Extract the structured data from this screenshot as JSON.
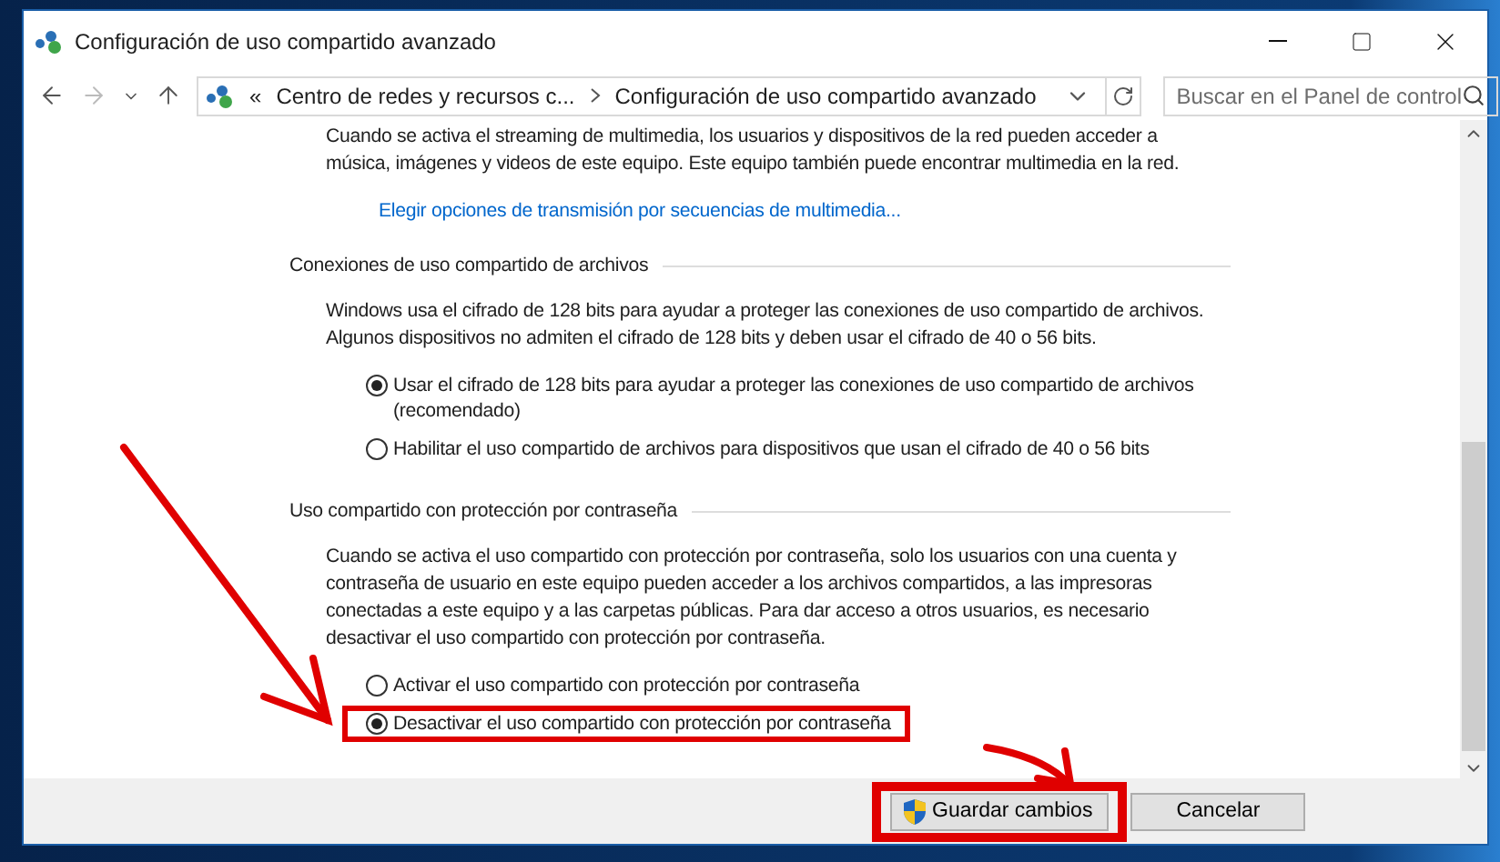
{
  "window": {
    "title": "Configuración de uso compartido avanzado"
  },
  "address_bar": {
    "overflow": "«",
    "crumbs": [
      {
        "label": "Centro de redes y recursos c..."
      },
      {
        "label": "Configuración de uso compartido avanzado"
      }
    ]
  },
  "search": {
    "placeholder": "Buscar en el Panel de control"
  },
  "intro": {
    "paragraph": "Cuando se activa el streaming de multimedia, los usuarios y dispositivos de la red pueden acceder a música, imágenes y videos de este equipo. Este equipo también puede encontrar multimedia en la red.",
    "link": "Elegir opciones de transmisión por secuencias de multimedia..."
  },
  "sections": [
    {
      "heading": "Conexiones de uso compartido de archivos",
      "paragraph": "Windows usa el cifrado de 128 bits para ayudar a proteger las conexiones de uso compartido de archivos. Algunos dispositivos no admiten el cifrado de 128 bits y deben usar el cifrado de 40 o 56 bits.",
      "options": [
        {
          "label": "Usar el cifrado de 128 bits para ayudar a proteger las conexiones de uso compartido de archivos (recomendado)",
          "selected": true,
          "highlighted": false
        },
        {
          "label": "Habilitar el uso compartido de archivos para dispositivos que usan el cifrado de 40 o 56 bits",
          "selected": false,
          "highlighted": false
        }
      ]
    },
    {
      "heading": "Uso compartido con protección por contraseña",
      "paragraph": "Cuando se activa el uso compartido con protección por contraseña, solo los usuarios con una cuenta y contraseña de usuario en este equipo pueden acceder a los archivos compartidos, a las impresoras conectadas a este equipo y a las carpetas públicas. Para dar acceso a otros usuarios, es necesario desactivar el uso compartido con protección por contraseña.",
      "options": [
        {
          "label": "Activar el uso compartido con protección por contraseña",
          "selected": false,
          "highlighted": false
        },
        {
          "label": "Desactivar el uso compartido con protección por contraseña",
          "selected": true,
          "highlighted": true
        }
      ]
    }
  ],
  "buttons": [
    {
      "label": "Guardar cambios",
      "kind": "shield",
      "highlighted": true
    },
    {
      "label": "Cancelar",
      "kind": "plain",
      "highlighted": false
    }
  ]
}
